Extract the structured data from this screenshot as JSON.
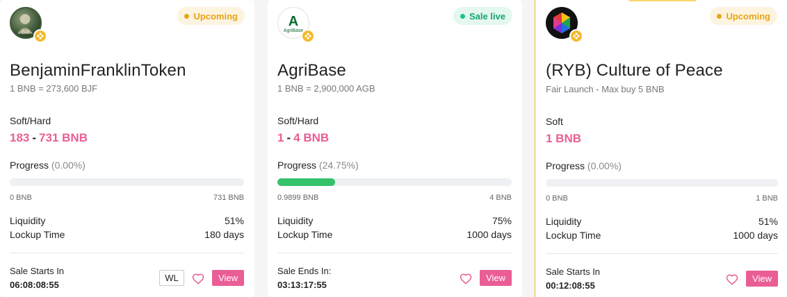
{
  "colors": {
    "accent": "#ea5d95",
    "progress_fill": "#35c26b",
    "upcoming": "#e8a317",
    "live": "#17a36b",
    "chain_badge": "#f3ba2f"
  },
  "cards": [
    {
      "logo_icon": "portrait-coin-logo",
      "logo_text": "BJF",
      "chain_icon": "bnb-icon",
      "status": "Upcoming",
      "title": "BenjaminFranklinToken",
      "subtitle": "1 BNB = 273,600 BJF",
      "cap_label": "Soft/Hard",
      "cap_soft": "183",
      "cap_sep": "-",
      "cap_hard": "731 BNB",
      "progress_label": "Progress",
      "progress_pct": "(0.00%)",
      "progress_fraction": 0,
      "progress_min": "0 BNB",
      "progress_max": "731 BNB",
      "liquidity_label": "Liquidity",
      "liquidity_value": "51%",
      "lockup_label": "Lockup Time",
      "lockup_value": "180 days",
      "sale_label": "Sale Starts In",
      "timer": "06:08:08:55",
      "wl_label": "WL",
      "view_label": "View"
    },
    {
      "logo_icon": "agribase-logo",
      "logo_mark": "A",
      "logo_text": "AgriBase",
      "chain_icon": "bnb-icon",
      "status": "Sale live",
      "title": "AgriBase",
      "subtitle": "1 BNB = 2,900,000 AGB",
      "cap_label": "Soft/Hard",
      "cap_soft": "1",
      "cap_sep": "-",
      "cap_hard": "4 BNB",
      "progress_label": "Progress",
      "progress_pct": "(24.75%)",
      "progress_fraction": 0.2475,
      "progress_min": "0.9899 BNB",
      "progress_max": "4 BNB",
      "liquidity_label": "Liquidity",
      "liquidity_value": "75%",
      "lockup_label": "Lockup Time",
      "lockup_value": "1000 days",
      "sale_label": "Sale Ends In:",
      "timer": "03:13:17:55",
      "view_label": "View"
    },
    {
      "logo_icon": "hexagon-colorful-logo",
      "chain_icon": "bnb-icon",
      "status": "Upcoming",
      "title": "(RYB) Culture of Peace",
      "subtitle": "Fair Launch - Max buy 5 BNB",
      "cap_label": "Soft",
      "cap_soft": "1 BNB",
      "progress_label": "Progress",
      "progress_pct": "(0.00%)",
      "progress_fraction": 0,
      "progress_min": "0 BNB",
      "progress_max": "1 BNB",
      "liquidity_label": "Liquidity",
      "liquidity_value": "51%",
      "lockup_label": "Lockup Time",
      "lockup_value": "1000 days",
      "sale_label": "Sale Starts In",
      "timer": "00:12:08:55",
      "view_label": "View"
    }
  ]
}
